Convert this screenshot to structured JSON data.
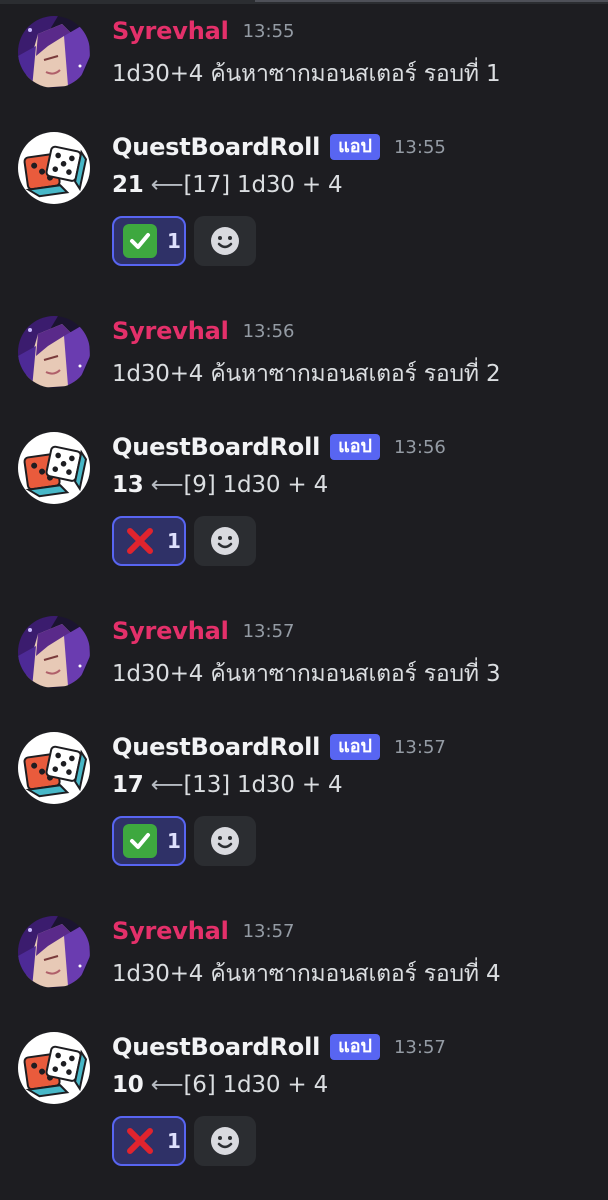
{
  "colors": {
    "background": "#1d1d21",
    "user_name": "#e4306a",
    "bot_name": "#f2f3f5",
    "badge": "#5865f2",
    "reaction_border": "#5865f2",
    "reaction_bg": "#2f3167"
  },
  "messages": [
    {
      "author": "Syrevhal",
      "time": "13:55",
      "text": "1d30+4 ค้นหาซากมอนสเตอร์ รอบที่ 1"
    },
    {
      "author": "QuestBoardRoll",
      "badge": "แอป",
      "time": "13:55",
      "total": "21",
      "arrow": " ⟵",
      "detail": "[17] 1d30 + 4",
      "reaction": {
        "emoji": "check-mark-button-icon",
        "count": "1"
      }
    },
    {
      "author": "Syrevhal",
      "time": "13:56",
      "text": "1d30+4 ค้นหาซากมอนสเตอร์ รอบที่ 2"
    },
    {
      "author": "QuestBoardRoll",
      "badge": "แอป",
      "time": "13:56",
      "total": "13",
      "arrow": " ⟵",
      "detail": "[9] 1d30 + 4",
      "reaction": {
        "emoji": "cross-mark-icon",
        "count": "1"
      }
    },
    {
      "author": "Syrevhal",
      "time": "13:57",
      "text": "1d30+4 ค้นหาซากมอนสเตอร์ รอบที่ 3"
    },
    {
      "author": "QuestBoardRoll",
      "badge": "แอป",
      "time": "13:57",
      "total": "17",
      "arrow": " ⟵",
      "detail": "[13] 1d30 + 4",
      "reaction": {
        "emoji": "check-mark-button-icon",
        "count": "1"
      }
    },
    {
      "author": "Syrevhal",
      "time": "13:57",
      "text": "1d30+4 ค้นหาซากมอนสเตอร์ รอบที่ 4"
    },
    {
      "author": "QuestBoardRoll",
      "badge": "แอป",
      "time": "13:57",
      "total": "10",
      "arrow": " ⟵",
      "detail": "[6] 1d30 + 4",
      "reaction": {
        "emoji": "cross-mark-icon",
        "count": "1"
      }
    }
  ]
}
